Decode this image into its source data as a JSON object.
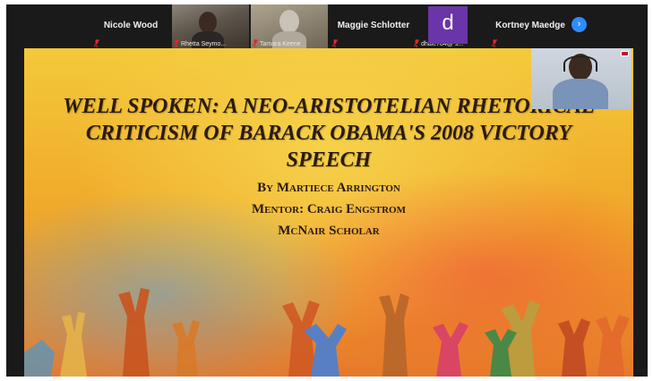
{
  "participants": [
    {
      "name": "Nicole Wood",
      "type": "name"
    },
    {
      "name": "Rhetta Seymo...",
      "type": "video"
    },
    {
      "name": "Tamara Keene",
      "type": "video"
    },
    {
      "name": "Maggie Schlotter",
      "type": "name"
    },
    {
      "name": "dhale784@ s...",
      "type": "avatar",
      "initial": "d"
    },
    {
      "name": "Kortney Maedge",
      "type": "name"
    }
  ],
  "next_page_icon": "chevron-right-icon",
  "slide": {
    "title_line1": "WELL SPOKEN: A NEO-ARISTOTELIAN RHETORICAL",
    "title_line2": "CRITICISM OF BARACK OBAMA'S 2008 VICTORY",
    "title_line3": "SPEECH",
    "author": "By Martiece Arrington",
    "mentor": "Mentor: Craig Engstrom",
    "program": "McNair Scholar"
  },
  "colors": {
    "window_bg": "#1a1a1a",
    "avatar_purple": "#6a35a8",
    "accent_blue": "#2d8cff",
    "muted_red": "#e02828"
  }
}
